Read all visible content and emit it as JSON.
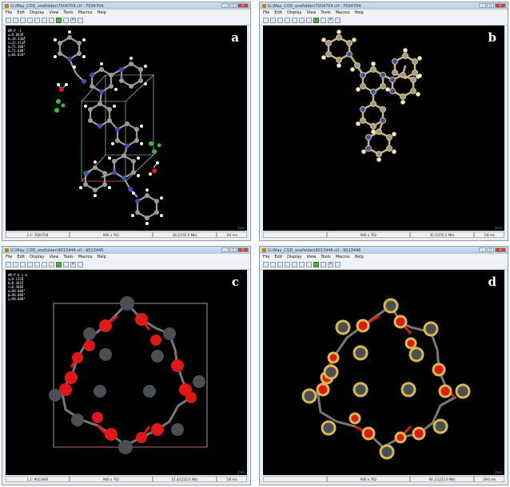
{
  "menu": [
    "File",
    "Edit",
    "Display",
    "View",
    "Tools",
    "Macros",
    "Help"
  ],
  "windows": [
    {
      "id": "a",
      "title": "G:\\May_COD_onefolder\\7004704.cif - 7004704",
      "label": "a",
      "info": [
        "HM:P -1",
        "a=9.093Å",
        "b=10.336Å",
        "c=12.413Å",
        "α=71.300°",
        "β=71.600°",
        "γ=66.020°"
      ],
      "status": [
        "1.1: 7004704",
        "900 x 762",
        "28.2/155.5 Mb)",
        "3/4 ms"
      ]
    },
    {
      "id": "b",
      "title": "G:\\May_COD_onefolder\\7004704.cif - 7004704",
      "label": "b",
      "info": [],
      "status": [
        "",
        "900 x 762",
        "35.5/155.5 Mb)",
        "7/8 ms"
      ]
    },
    {
      "id": "c",
      "title": "G:\\May_COD_onefolder\\9013446.cif - 9013446",
      "label": "c",
      "info": [
        "HM:P b c m",
        "a=9.135Å",
        "b=8.461Å",
        "c=6.588Å",
        "α=90.000°",
        "β=90.000°",
        "γ=90.000°"
      ],
      "status": [
        "1.1: 9013446",
        "900 x 762",
        "51.4/1222.6 Mb)",
        "5/6 ms"
      ]
    },
    {
      "id": "d",
      "title": "G:\\May_COD_onefolder\\9013446.cif - 9013446",
      "label": "d",
      "info": [],
      "status": [
        "",
        "900 x 762",
        "69.1/1222.6 Mb)",
        "19/0 ms"
      ]
    }
  ],
  "jmol_text": "Jmol",
  "colors": {
    "oxygen": "#e01818",
    "silicon": "#4a4e55",
    "halo": "#d9b94a",
    "carbon": "#888a90",
    "nitrogen": "#3a50b8",
    "hydrogen": "#ffffff",
    "chlorine": "#3cb83c",
    "cell": "#ffffff"
  }
}
